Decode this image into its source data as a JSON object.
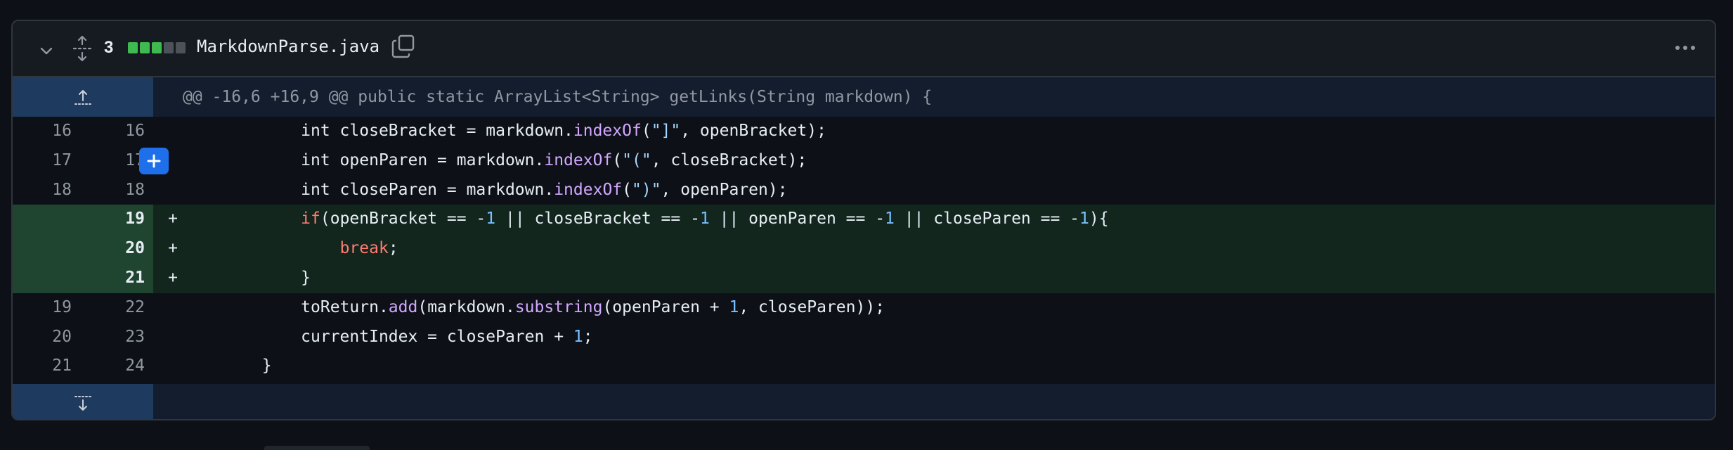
{
  "file": {
    "changes_count": "3",
    "diffstat_colors": [
      "#3fb950",
      "#3fb950",
      "#3fb950",
      "#4c525a",
      "#4c525a"
    ],
    "filename": "MarkdownParse.java",
    "hunk_header": "@@ -16,6 +16,9 @@ public static ArrayList<String> getLinks(String markdown) {",
    "icons": {
      "collapse": "chevron-down-icon",
      "expand": "unfold-icon",
      "copy": "copy-icon",
      "menu": "kebab-horizontal-icon",
      "expand_up": "expand-up-icon",
      "expand_down": "expand-down-icon",
      "add_comment": "plus-icon"
    }
  },
  "lines": [
    {
      "old": "16",
      "new": "16",
      "marker": "",
      "type": "context",
      "tokens": [
        [
          "",
          "            int closeBracket = markdown."
        ],
        [
          "fn",
          "indexOf"
        ],
        [
          "",
          "("
        ],
        [
          "str",
          "\"]\""
        ],
        [
          "",
          ", openBracket);"
        ]
      ]
    },
    {
      "old": "17",
      "new": "17",
      "marker": "",
      "type": "context",
      "tokens": [
        [
          "",
          "            int openParen = markdown."
        ],
        [
          "fn",
          "indexOf"
        ],
        [
          "",
          "("
        ],
        [
          "str",
          "\"(\""
        ],
        [
          "",
          ", closeBracket);"
        ]
      ]
    },
    {
      "old": "18",
      "new": "18",
      "marker": "",
      "type": "context",
      "tokens": [
        [
          "",
          "            int closeParen = markdown."
        ],
        [
          "fn",
          "indexOf"
        ],
        [
          "",
          "("
        ],
        [
          "str",
          "\")\""
        ],
        [
          "",
          ", openParen);"
        ]
      ]
    },
    {
      "old": "",
      "new": "19",
      "marker": "+",
      "type": "add",
      "tokens": [
        [
          "kw",
          "            if"
        ],
        [
          "",
          "(openBracket == -"
        ],
        [
          "num",
          "1"
        ],
        [
          "",
          " || closeBracket == -"
        ],
        [
          "num",
          "1"
        ],
        [
          "",
          " || openParen == -"
        ],
        [
          "num",
          "1"
        ],
        [
          "",
          " || closeParen == -"
        ],
        [
          "num",
          "1"
        ],
        [
          "",
          "){"
        ]
      ]
    },
    {
      "old": "",
      "new": "20",
      "marker": "+",
      "type": "add",
      "tokens": [
        [
          "",
          "                "
        ],
        [
          "kw",
          "break"
        ],
        [
          "",
          ";"
        ]
      ]
    },
    {
      "old": "",
      "new": "21",
      "marker": "+",
      "type": "add",
      "tokens": [
        [
          "",
          "            }"
        ]
      ]
    },
    {
      "old": "19",
      "new": "22",
      "marker": "",
      "type": "context",
      "tokens": [
        [
          "",
          "            toReturn."
        ],
        [
          "fn",
          "add"
        ],
        [
          "",
          "(markdown."
        ],
        [
          "fn",
          "substring"
        ],
        [
          "",
          "(openParen + "
        ],
        [
          "num",
          "1"
        ],
        [
          "",
          ", closeParen));"
        ]
      ]
    },
    {
      "old": "20",
      "new": "23",
      "marker": "",
      "type": "context",
      "tokens": [
        [
          "",
          "            currentIndex = closeParen + "
        ],
        [
          "num",
          "1"
        ],
        [
          "",
          ";"
        ]
      ]
    },
    {
      "old": "21",
      "new": "24",
      "marker": "",
      "type": "context",
      "tokens": [
        [
          "",
          "        }"
        ]
      ]
    }
  ]
}
